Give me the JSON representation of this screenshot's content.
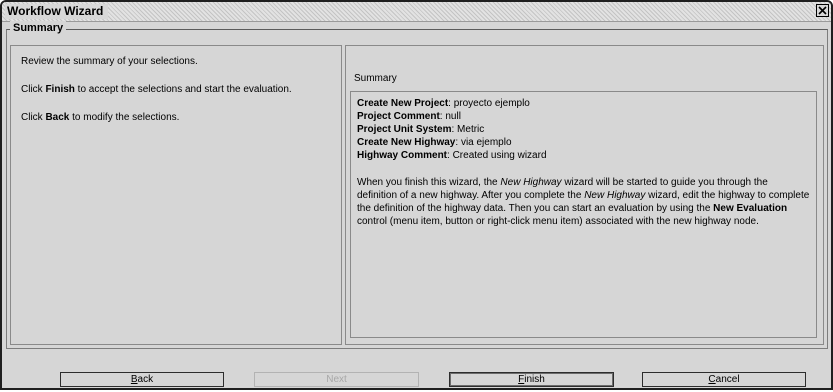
{
  "window": {
    "title": "Workflow Wizard",
    "close_icon": "close-icon"
  },
  "group": {
    "legend": "Summary"
  },
  "instructions": {
    "line1": "Review the summary of your selections.",
    "line2_pre": "Click ",
    "line2_bold": "Finish",
    "line2_post": " to accept the selections and start the evaluation.",
    "line3_pre": "Click ",
    "line3_bold": "Back",
    "line3_post": " to modify the selections."
  },
  "summary": {
    "header": "Summary",
    "items": [
      {
        "label": "Create New Project",
        "value": "proyecto ejemplo"
      },
      {
        "label": "Project Comment",
        "value": "null"
      },
      {
        "label": "Project Unit System",
        "value": "Metric"
      },
      {
        "label": "Create New Highway",
        "value": "via ejemplo"
      },
      {
        "label": "Highway Comment",
        "value": "Created using wizard"
      }
    ],
    "paragraph": {
      "p1": "When you finish this wizard, the ",
      "p2_i": "New Highway",
      "p3": " wizard will be started to guide you through the definition of a new highway. After you complete the ",
      "p4_i": "New Highway",
      "p5": " wizard, edit the highway to complete the definition of the highway data. Then you can start an evaluation by using the ",
      "p6_b": "New Evaluation",
      "p7": " control (menu item, button or right-click menu item) associated with the new highway node."
    }
  },
  "buttons": {
    "back": {
      "mnemonic": "B",
      "rest": "ack",
      "enabled": true
    },
    "next": {
      "label": "Next",
      "enabled": false
    },
    "finish": {
      "mnemonic": "F",
      "rest": "inish",
      "enabled": true
    },
    "cancel": {
      "mnemonic": "C",
      "rest": "ancel",
      "enabled": true
    }
  }
}
